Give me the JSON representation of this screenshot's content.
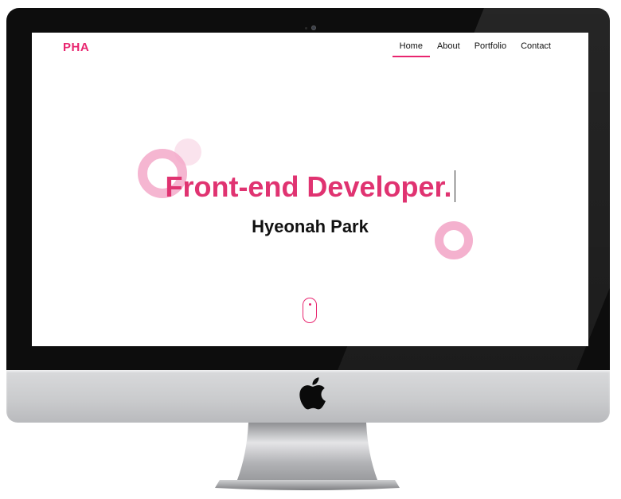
{
  "site": {
    "logo": "PHA",
    "accent_color": "#e8256f"
  },
  "nav": {
    "items": [
      {
        "label": "Home",
        "active": true
      },
      {
        "label": "About",
        "active": false
      },
      {
        "label": "Portfolio",
        "active": false
      },
      {
        "label": "Contact",
        "active": false
      }
    ]
  },
  "hero": {
    "title": "Front-end Developer.",
    "subtitle": "Hyeonah Park"
  },
  "icons": {
    "scroll": "mouse-scroll-icon",
    "brand": "apple-logo-icon"
  }
}
